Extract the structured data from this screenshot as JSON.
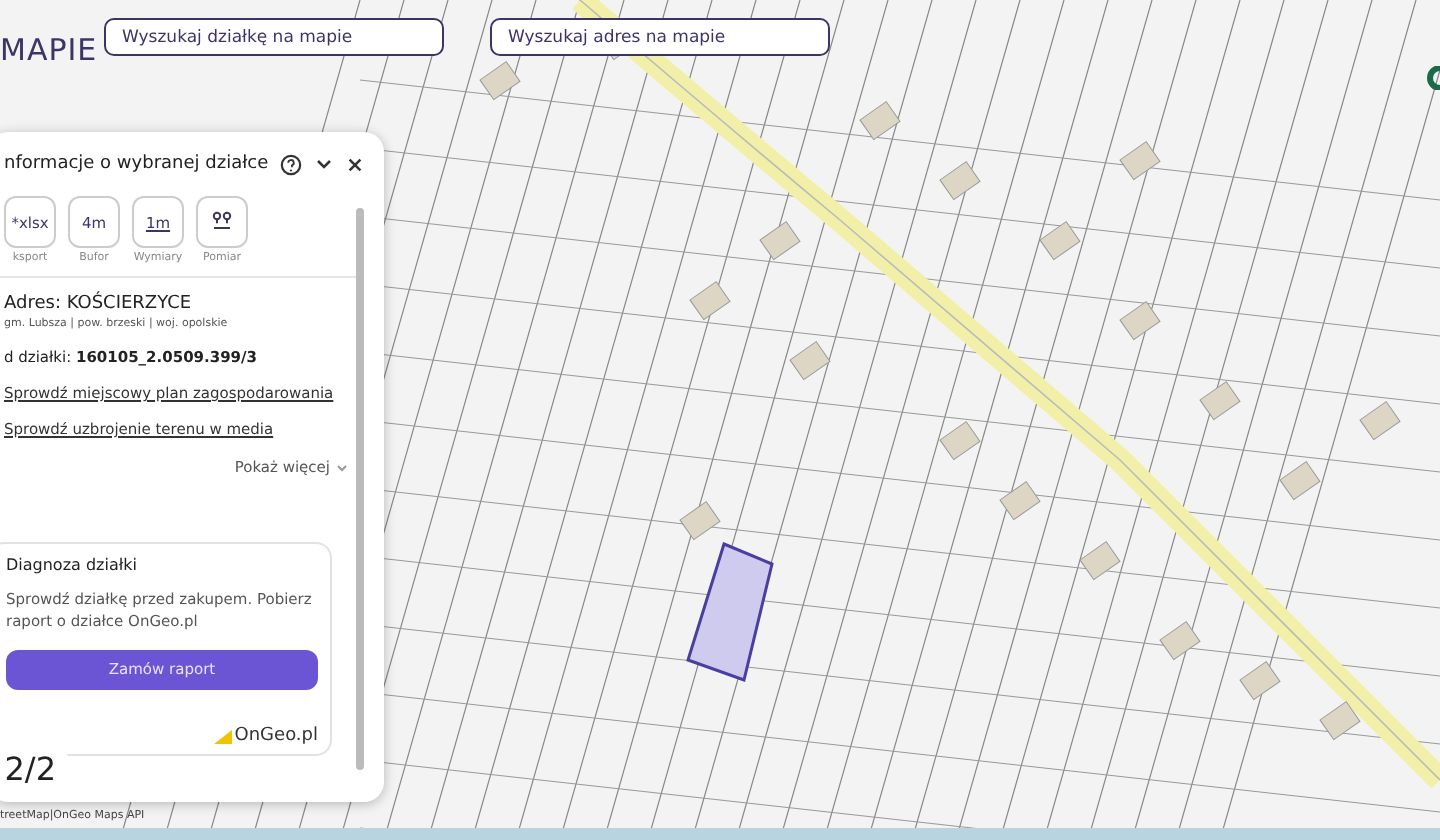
{
  "brand": {
    "text": "MAPIE"
  },
  "search_fields": [
    {
      "placeholder": "Wyszukaj działkę na mapie"
    },
    {
      "placeholder": "Wyszukaj adres na mapie"
    }
  ],
  "panel": {
    "title": "nformacje o wybranej działce",
    "tools": [
      {
        "kind": "text",
        "icon_text": "*xlsx",
        "label": "ksport"
      },
      {
        "kind": "text",
        "icon_text": "4m",
        "label": "Bufor"
      },
      {
        "kind": "underline",
        "icon_text": "1m",
        "label": "Wymiary"
      },
      {
        "kind": "measure",
        "label": "Pomiar"
      }
    ],
    "address": "Adres: KOŚCIERZYCE",
    "region": "gm. Lubsza | pow. brzeski | woj. opolskie",
    "parcel_id": "d działki: **160105_2.0509.399/3**",
    "links": [
      "Sprowdź miejscowy plan zagospodarowania",
      "Sprowdź uzbrojenie terenu w media"
    ],
    "show_more": "Pokaż więcej",
    "card": {
      "title": "Diagnoza działki",
      "text": "Sprowdź działkę przed zakupem. Pobierz raport o działce OnGeo.pl",
      "button": "Zamów raport",
      "logo": "OnGeo.pl"
    }
  },
  "pager": "2/2",
  "attribution": "treetMap|OnGeo Maps API"
}
